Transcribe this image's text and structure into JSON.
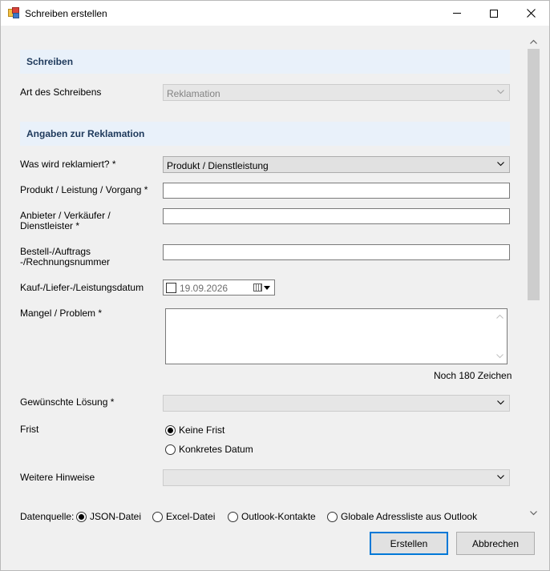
{
  "window": {
    "title": "Schreiben erstellen"
  },
  "sections": {
    "schreiben": "Schreiben",
    "angaben": "Angaben zur Reklamation"
  },
  "art": {
    "label": "Art des Schreibens",
    "value": "Reklamation"
  },
  "was": {
    "label": "Was wird reklamiert? *",
    "value": "Produkt / Dienstleistung"
  },
  "produkt": {
    "label": "Produkt / Leistung / Vorgang *",
    "value": ""
  },
  "anbieter": {
    "label_line1": "Anbieter / Verkäufer /",
    "label_line2": "Dienstleister *",
    "value": ""
  },
  "bestell": {
    "label_line1": "Bestell-/Auftrags",
    "label_line2": "-/Rechnungsnummer",
    "value": ""
  },
  "datum": {
    "label": "Kauf-/Liefer-/Leistungsdatum",
    "value": "19.09.2026"
  },
  "mangel": {
    "label": "Mangel / Problem *",
    "value": "",
    "counter": "Noch 180 Zeichen"
  },
  "loesung": {
    "label": "Gewünschte Lösung *",
    "value": ""
  },
  "frist": {
    "label": "Frist",
    "options": [
      "Keine Frist",
      "Konkretes Datum"
    ],
    "selected": "Keine Frist"
  },
  "hinweise": {
    "label": "Weitere Hinweise",
    "value": ""
  },
  "datenquelle": {
    "label": "Datenquelle:",
    "options": [
      "JSON-Datei",
      "Excel-Datei",
      "Outlook-Kontakte",
      "Globale Adressliste aus Outlook"
    ],
    "selected": "JSON-Datei"
  },
  "buttons": {
    "create": "Erstellen",
    "cancel": "Abbrechen"
  },
  "colors": {
    "section_bg": "#e9f1fa",
    "section_text": "#1e395b",
    "focus_border": "#0078d7"
  }
}
